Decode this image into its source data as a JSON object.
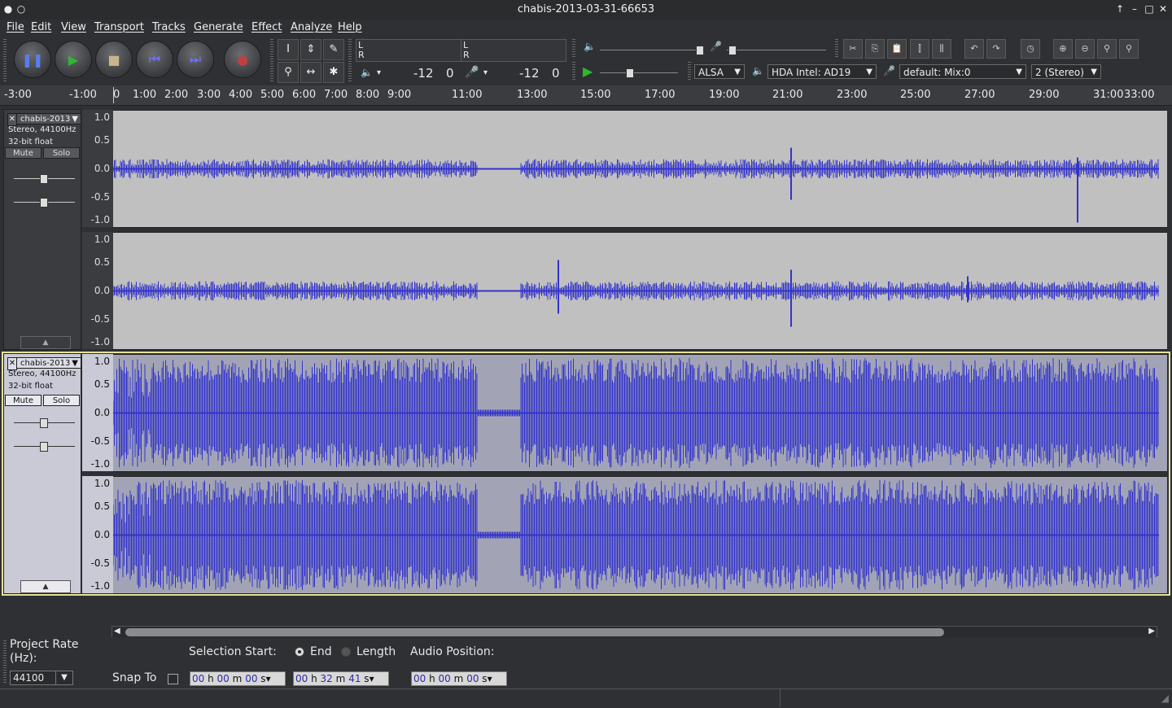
{
  "window": {
    "title": "chabis-2013-03-31-66653"
  },
  "menu": [
    "File",
    "Edit",
    "View",
    "Transport",
    "Tracks",
    "Generate",
    "Effect",
    "Analyze",
    "Help"
  ],
  "meters": {
    "record_db": "-12",
    "record_zero": "0",
    "play_db": "-12",
    "play_zero": "0",
    "lr_left": "L",
    "lr_right": "R"
  },
  "device": {
    "host": "ALSA",
    "output": "HDA Intel: AD19",
    "input": "default: Mix:0",
    "channels": "2 (Stereo)"
  },
  "ruler": {
    "ticks": [
      "-3:00",
      "-1:00",
      "0",
      "1:00",
      "2:00",
      "3:00",
      "4:00",
      "5:00",
      "6:00",
      "7:00",
      "8:00",
      "9:00",
      "11:00",
      "13:00",
      "15:00",
      "17:00",
      "19:00",
      "21:00",
      "23:00",
      "25:00",
      "27:00",
      "29:00",
      "31:00",
      "33:00"
    ]
  },
  "tracks": [
    {
      "name": "chabis-2013",
      "format": "Stereo, 44100Hz",
      "bits": "32-bit float",
      "mute": "Mute",
      "solo": "Solo",
      "selected": false,
      "scale": [
        "1.0",
        "0.5",
        "0.0",
        "-0.5",
        "-1.0"
      ]
    },
    {
      "name": "chabis-2013",
      "format": "Stereo, 44100Hz",
      "bits": "32-bit float",
      "mute": "Mute",
      "solo": "Solo",
      "selected": true,
      "scale": [
        "1.0",
        "0.5",
        "0.0",
        "-0.5",
        "-1.0"
      ]
    }
  ],
  "bottom": {
    "project_rate_label": "Project Rate (Hz):",
    "project_rate": "44100",
    "snap_to": "Snap To",
    "selection_start": "Selection Start:",
    "end": "End",
    "length": "Length",
    "audio_position": "Audio Position:",
    "start_time": {
      "h": "00",
      "m": "00",
      "s": "00"
    },
    "end_time": {
      "h": "00",
      "m": "32",
      "s": "41"
    },
    "audio_time": {
      "h": "00",
      "m": "00",
      "s": "00"
    },
    "unit_h": "h",
    "unit_m": "m",
    "unit_s": "s"
  },
  "colors": {
    "wave": "#3333cc",
    "wave_bg": "#c0c0c0",
    "wave_bg_selected": "#a2a4b6",
    "selection_border": "#e6e29a"
  }
}
